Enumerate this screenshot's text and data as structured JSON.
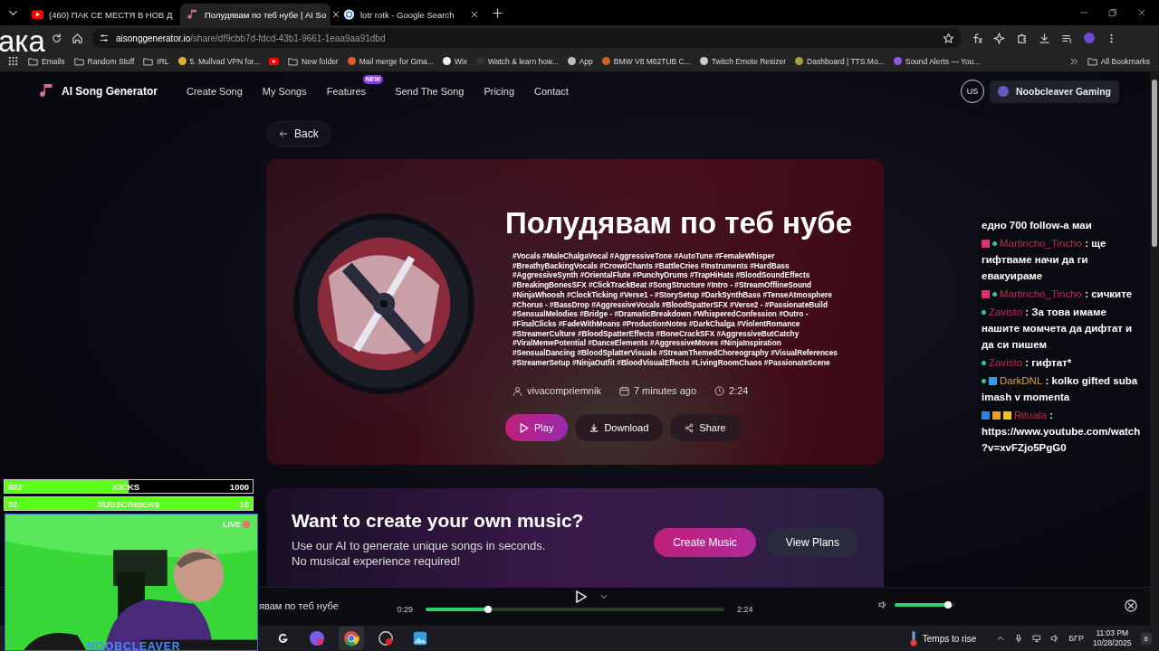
{
  "tabs": [
    {
      "title": "(460) ПАК СЕ МЕСТЯ В НОВ Д",
      "kind": "video",
      "selected": false
    },
    {
      "title": "Полудявам по теб нубе | AI So",
      "kind": "note",
      "selected": true
    },
    {
      "title": "lotr rotk - Google Search",
      "kind": "globe",
      "selected": false
    }
  ],
  "address": {
    "host": "aisonggenerator.io",
    "path": "/share/df9cbb7d-fdcd-43b1-9661-1eaa9aa91dbd"
  },
  "bookmarks": [
    {
      "label": "Emails",
      "kind": "folder"
    },
    {
      "label": "Random Stuff",
      "kind": "folder"
    },
    {
      "label": "IRL",
      "kind": "folder"
    },
    {
      "label": "5. Mullvad VPN for...",
      "kind": "site",
      "color": "#e0b030"
    },
    {
      "kind": "video"
    },
    {
      "label": "New folder",
      "kind": "folder"
    },
    {
      "label": "Mail merge for Gma...",
      "kind": "site",
      "color": "#e05a2a"
    },
    {
      "label": "Wix",
      "kind": "site",
      "color": "#eeeeee"
    },
    {
      "label": "Watch & learn how...",
      "kind": "site",
      "color": "#333333"
    },
    {
      "label": "App",
      "kind": "site",
      "color": "#bbbbbb"
    },
    {
      "label": "BMW V8 M62TUB C...",
      "kind": "site",
      "color": "#d06020"
    },
    {
      "label": "Twitch Emote Resizer",
      "kind": "site",
      "color": "#cccccc"
    },
    {
      "label": "Dashboard | TTS.Mo...",
      "kind": "site",
      "color": "#a0a040"
    },
    {
      "label": "Sound Alerts — You...",
      "kind": "site",
      "color": "#8a5ae0"
    }
  ],
  "all_bookmarks": "All Bookmarks",
  "site": {
    "logo": "AI Song Generator",
    "nav": [
      {
        "label": "Create Song"
      },
      {
        "label": "My Songs"
      },
      {
        "label": "Features",
        "badge": "NEW"
      },
      {
        "label": "Send The Song"
      },
      {
        "label": "Pricing"
      },
      {
        "label": "Contact"
      }
    ],
    "lang": "US",
    "user": "Noobcleaver Gaming"
  },
  "back": "Back",
  "song": {
    "title": "Полудявам по теб нубе",
    "tags": "#Vocals #MaleChalgaVocal #AggressiveTone #AutoTune #FemaleWhisper #BreathyBackingVocals #CrowdChants #BattleCries #Instruments #HardBass #AggressiveSynth #OrientalFlute #PunchyDrums #TrapHiHats #BloodSoundEffects #BreakingBonesSFX #ClickTrackBeat #SongStructure #Intro - #StreamOfflineSound #NinjaWhoosh #ClockTicking #Verse1 - #StorySetup #DarkSynthBass #TenseAtmosphere #Chorus - #BassDrop #AggressiveVocals #BloodSpatterSFX #Verse2 - #PassionateBuild #SensualMelodies #Bridge - #DramaticBreakdown #WhisperedConfession #Outro - #FinalClicks #FadeWithMoans #ProductionNotes #DarkChalga #ViolentRomance #StreamerCulture #BloodSpatterEffects #BoneCrackSFX #AggressiveButCatchy #ViralMemePotential #DanceElements #AggressiveMoves #NinjaInspiration #SensualDancing #BloodSplatterVisuals #StreamThemedChoreography #VisualReferences #StreamerSetup #NinjaOutfit #BloodVisualEffects #LivingRoomChaos #PassionateScene",
    "meta": [
      {
        "kind": "user",
        "text": "vivacompriemnik"
      },
      {
        "kind": "calendar",
        "text": "7 minutes ago"
      },
      {
        "kind": "clock",
        "text": "2:24"
      }
    ],
    "actions": [
      {
        "kind": "play",
        "label": "Play"
      },
      {
        "kind": "download",
        "label": "Download"
      },
      {
        "kind": "share",
        "label": "Share"
      }
    ]
  },
  "promo": {
    "title": "Want to create your own music?",
    "lines": [
      "Use our AI to generate unique songs in seconds.",
      "No musical experience required!"
    ],
    "primary": "Create Music",
    "secondary": "View Plans"
  },
  "player": {
    "title": "явам по теб нубе",
    "elapsed": "0:29",
    "total": "2:24",
    "level": 0.21,
    "volume": {
      "level": 0.9
    }
  },
  "taskbar": {
    "weather": "Temps to rise",
    "lang": "БГР",
    "time": "11:03 PM",
    "date": "10/28/2025",
    "notifications": "6"
  },
  "overlay": {
    "fragment": "ака",
    "goals": [
      {
        "current": "502",
        "label": "KICKS",
        "target": "1000",
        "level": 0.5
      },
      {
        "current": "32",
        "label": "SUBSCRIBERS",
        "target": "10",
        "level": 1
      }
    ],
    "live": "LIVE",
    "name": "NOOBCLEAVER",
    "chat": [
      {
        "text": "едно 700 follow-а маи"
      },
      {
        "user": "Martincho_Tincho",
        "color": "#c8264c",
        "text": ": ще гифтваме начи да ги евакуираме",
        "badges": [
          {
            "kind": "cube"
          },
          {
            "kind": "dot"
          }
        ]
      },
      {
        "user": "Martincho_Tincho",
        "color": "#c8264c",
        "text": ": сичките",
        "badges": [
          {
            "kind": "cube"
          },
          {
            "kind": "dot"
          }
        ]
      },
      {
        "user": "Zavisto",
        "color": "#c8264c",
        "text": ": За това имаме нашите момчета да дифтат и да си пишем",
        "badges": [
          {
            "kind": "dot"
          }
        ]
      },
      {
        "user": "Zavisto",
        "color": "#c8264c",
        "text": ": гифтат*",
        "badges": [
          {
            "kind": "dot"
          }
        ]
      },
      {
        "user": "DarkDNL",
        "color": "#e0a030",
        "text": ": kolko gifted suba imash v momenta",
        "badges": [
          {
            "kind": "drop"
          },
          {
            "kind": "grid"
          }
        ]
      },
      {
        "user": "Rituala",
        "color": "#c8264c",
        "text": ": https://www.youtube.com/watch?v=xvFZjo5PgG0",
        "badges": [
          {
            "kind": "hammer"
          },
          {
            "kind": "box"
          },
          {
            "kind": "crown"
          }
        ]
      }
    ]
  }
}
